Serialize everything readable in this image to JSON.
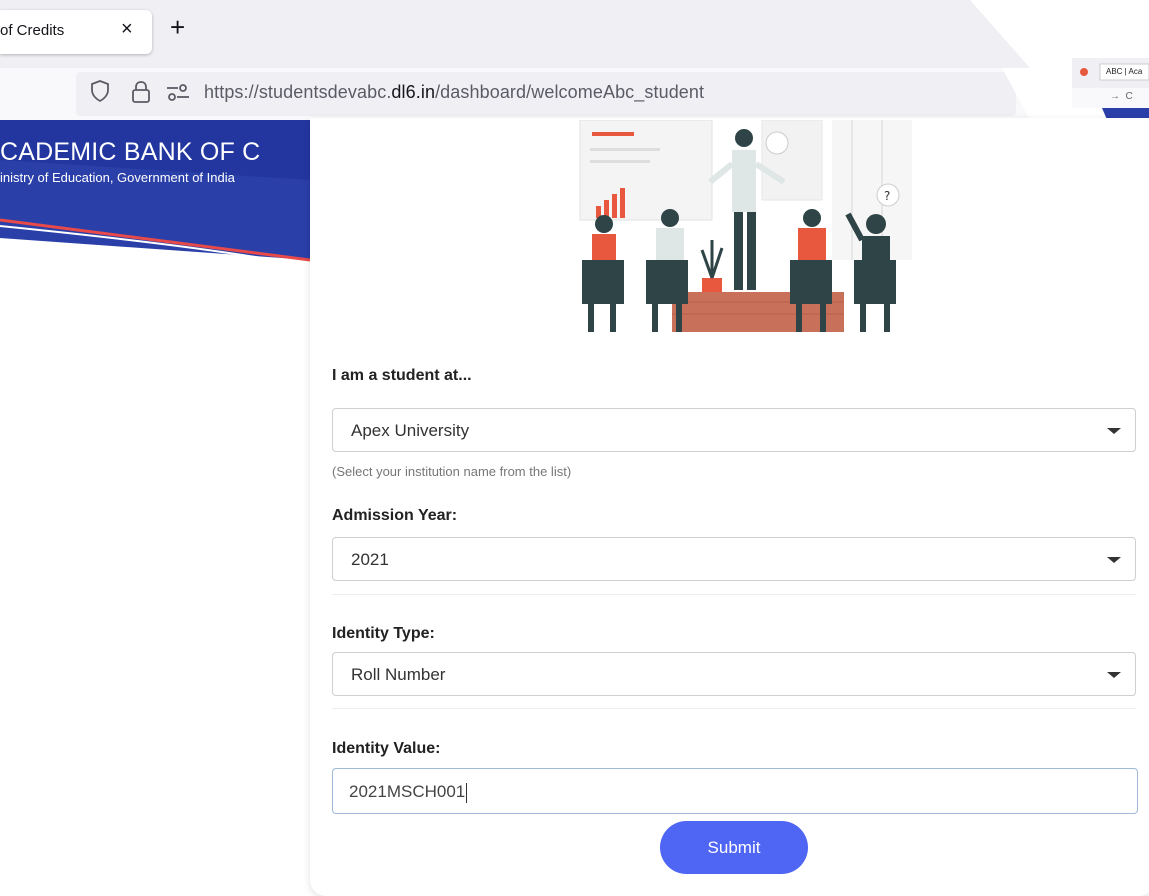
{
  "browser": {
    "tab_title": "of Credits",
    "tab_close": "×",
    "new_tab": "+",
    "url_prefix": "https://studentsdevabc.",
    "url_domain": "dl6.in",
    "url_path": "/dashboard/welcomeAbc_student",
    "mini_tab_title": "ABC | Aca",
    "mini_nav": "→  C"
  },
  "header": {
    "title": "CADEMIC BANK OF C",
    "subtitle": "inistry of Education, Government of India"
  },
  "form": {
    "institution_label": "I am a student at...",
    "institution_value": "Apex University",
    "institution_help": "(Select your institution name from the list)",
    "admission_label": "Admission Year:",
    "admission_value": "2021",
    "identity_type_label": "Identity Type:",
    "identity_type_value": "Roll Number",
    "identity_value_label": "Identity Value:",
    "identity_value": "2021MSCH001",
    "submit_label": "Submit"
  },
  "colors": {
    "header_blue": "#2a3fa8",
    "accent_red": "#e84a4a",
    "submit_blue": "#4f66f4",
    "illustration_orange": "#e8583f",
    "illustration_dark": "#2f4447"
  }
}
